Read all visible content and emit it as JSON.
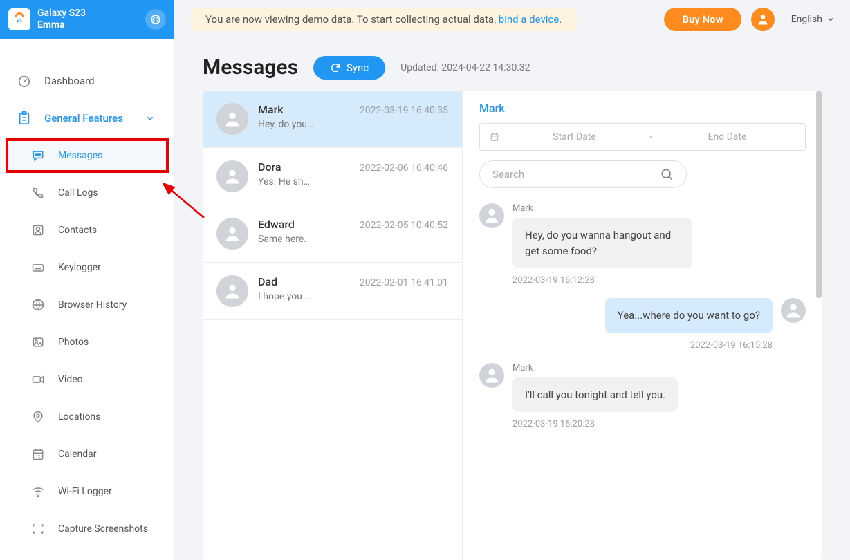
{
  "header": {
    "device_model": "Galaxy S23",
    "device_user": "Emma",
    "buy_label": "Buy Now",
    "lang_label": "English",
    "banner_text": "You are now viewing demo data. To start collecting actual data, ",
    "banner_link": "bind a device",
    "banner_tail": "."
  },
  "nav": {
    "dashboard": "Dashboard",
    "general_features": "General Features",
    "messages": "Messages",
    "call_logs": "Call Logs",
    "contacts": "Contacts",
    "keylogger": "Keylogger",
    "browser_history": "Browser History",
    "photos": "Photos",
    "video": "Video",
    "locations": "Locations",
    "calendar": "Calendar",
    "wifi_logger": "Wi-Fi Logger",
    "capture_screenshots": "Capture Screenshots"
  },
  "page": {
    "title": "Messages",
    "sync_label": "Sync",
    "updated_prefix": "Updated: ",
    "updated_value": "2024-04-22 14:30:32"
  },
  "conversations": [
    {
      "name": "Mark",
      "time": "2022-03-19 16:40:35",
      "preview": "Hey, do you…"
    },
    {
      "name": "Dora",
      "time": "2022-02-06 16:40:46",
      "preview": "Yes. He sh…"
    },
    {
      "name": "Edward",
      "time": "2022-02-05 10:40:52",
      "preview": "Same here."
    },
    {
      "name": "Dad",
      "time": "2022-02-01 16:41:01",
      "preview": "I hope you …"
    }
  ],
  "chat": {
    "name": "Mark",
    "start_placeholder": "Start Date",
    "end_placeholder": "End Date",
    "separator": "-",
    "search_placeholder": "Search",
    "messages": [
      {
        "side": "left",
        "sender": "Mark",
        "text": "Hey, do you wanna hangout and get some food?",
        "time": "2022-03-19 16:12:28"
      },
      {
        "side": "right",
        "sender": "",
        "text": "Yea...where do you want to go?",
        "time": "2022-03-19 16:15:28"
      },
      {
        "side": "left",
        "sender": "Mark",
        "text": "I'll call you tonight and tell you.",
        "time": "2022-03-19 16:20:28"
      }
    ]
  }
}
